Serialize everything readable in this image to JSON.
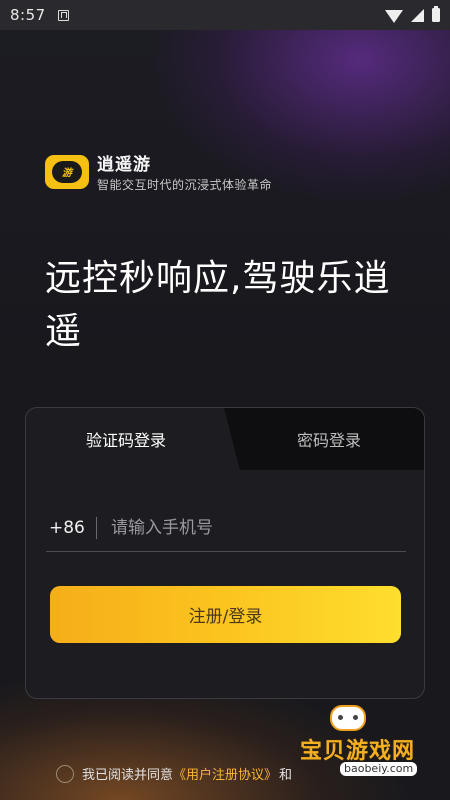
{
  "status_bar": {
    "time": "8:57"
  },
  "brand": {
    "logo_text": "游",
    "name": "逍遥游",
    "slogan": "智能交互时代的沉浸式体验革命"
  },
  "headline": "远控秒响应,驾驶乐逍遥",
  "login": {
    "tabs": [
      {
        "label": "验证码登录",
        "active": true
      },
      {
        "label": "密码登录",
        "active": false
      }
    ],
    "country_code": "+86",
    "phone_placeholder": "请输入手机号",
    "submit_label": "注册/登录"
  },
  "agreement": {
    "prefix": "我已阅读并同意",
    "user_agreement": "《用户注册协议》",
    "conjunction": "和"
  },
  "watermark": {
    "title": "宝贝游戏网",
    "url": "baobeiy.com"
  },
  "colors": {
    "accent": "#fbc21e",
    "link": "#f7b733",
    "background": "#1a1a1f"
  }
}
